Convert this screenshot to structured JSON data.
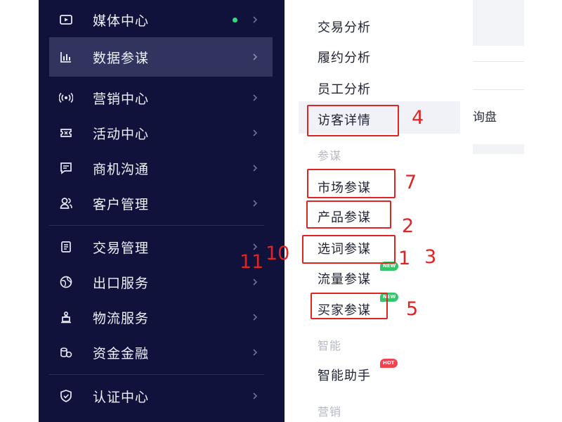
{
  "sidebar": {
    "items": [
      {
        "label": "媒体中心",
        "icon": "video-icon"
      },
      {
        "label": "数据参谋",
        "icon": "bar-chart-icon"
      },
      {
        "label": "营销中心",
        "icon": "broadcast-icon"
      },
      {
        "label": "活动中心",
        "icon": "ticket-icon"
      },
      {
        "label": "商机沟通",
        "icon": "chat-icon"
      },
      {
        "label": "客户管理",
        "icon": "users-icon"
      },
      {
        "label": "交易管理",
        "icon": "document-icon"
      },
      {
        "label": "出口服务",
        "icon": "globe-icon"
      },
      {
        "label": "物流服务",
        "icon": "delivery-icon"
      },
      {
        "label": "资金金融",
        "icon": "coins-icon"
      },
      {
        "label": "认证中心",
        "icon": "shield-icon"
      }
    ]
  },
  "submenu": {
    "items": {
      "trade_analysis": "交易分析",
      "fulfillment_analysis": "履约分析",
      "staff_analysis": "员工分析",
      "visitor_details": "访客详情",
      "market_advisor": "市场参谋",
      "product_advisor": "产品参谋",
      "keyword_advisor": "选词参谋",
      "traffic_advisor": "流量参谋",
      "buyer_advisor": "买家参谋",
      "smart_assistant": "智能助手"
    },
    "groups": {
      "advisor": "参谋",
      "smart": "智能",
      "marketing": "营销"
    },
    "badges": {
      "new1": "NEW",
      "new2": "NEW",
      "hot": "HOT"
    }
  },
  "annotations": {
    "a4": "4",
    "a7": "7",
    "a2": "2",
    "a1": "1",
    "a3": "3",
    "a5": "5",
    "a10": "10",
    "a11": "11"
  },
  "right_panel": {
    "text": "询盘"
  },
  "colors": {
    "sidebar_bg": "#10123c",
    "active_bg": "#31345e",
    "annotation_red": "#e02424",
    "new_badge": "#35c56a",
    "hot_badge": "#f0424f",
    "status_dot": "#2ee07a"
  }
}
